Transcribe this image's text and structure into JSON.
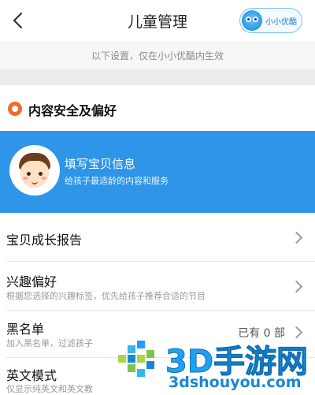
{
  "header": {
    "title": "儿童管理",
    "app_badge_label": "小小优酷"
  },
  "notice": "以下设置，仅在小小优酷内生效",
  "section": {
    "title": "内容安全及偏好"
  },
  "banner": {
    "title": "填写宝贝信息",
    "subtitle": "给孩子最适龄的内容和服务"
  },
  "settings": [
    {
      "label": "宝贝成长报告",
      "subtitle": "",
      "value": ""
    },
    {
      "label": "兴趣偏好",
      "subtitle": "根据您选择的兴趣标签，优先给孩子推荐合适的节目",
      "value": ""
    },
    {
      "label": "黑名单",
      "subtitle": "加入黑名单，过滤孩子",
      "value": "已有 0 部"
    },
    {
      "label": "英文模式",
      "subtitle": "仅显示纯英文和英文教",
      "value": ""
    }
  ],
  "watermark": {
    "brand": "3D手游网",
    "url": "3dshouyou.com"
  },
  "colors": {
    "accent_blue": "#2f95e8",
    "section_icon": "#f36a2a",
    "watermark_blue": "#1ea1f2"
  }
}
